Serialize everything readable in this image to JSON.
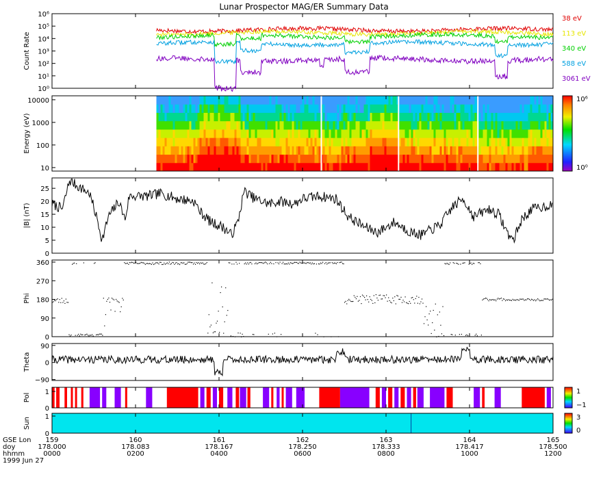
{
  "title": "Lunar Prospector MAG/ER Summary Data",
  "x_axis": {
    "rows": [
      {
        "label": "GSE Lon",
        "values": [
          "159",
          "160",
          "161",
          "162",
          "163",
          "164",
          "165"
        ]
      },
      {
        "label": "doy",
        "values": [
          "178.000",
          "178.083",
          "178.167",
          "178.250",
          "178.333",
          "178.417",
          "178.500"
        ]
      },
      {
        "label": "hhmm",
        "values": [
          "0000",
          "0200",
          "0400",
          "0600",
          "0800",
          "1000",
          "1200"
        ]
      }
    ],
    "date_label": "1999 Jun 27",
    "xlim_hours": [
      0,
      12
    ]
  },
  "colors": {
    "e38": "#e00000",
    "e113": "#e6e600",
    "e340": "#00d000",
    "e588": "#00a0e0",
    "e3061": "#8000c0",
    "pol_pos": "#ff0000",
    "pol_neg": "#8800ff",
    "sun": "#00e5ee"
  },
  "chart_data": [
    {
      "type": "line",
      "name": "count-rate",
      "ylabel": "Count Rate",
      "yscale": "log",
      "ylim": [
        1,
        1000000
      ],
      "yticks": [
        "10⁰",
        "10¹",
        "10²",
        "10³",
        "10⁴",
        "10⁵",
        "10⁶"
      ],
      "legend_placement": "right",
      "data_start_hour": 2.5,
      "series": [
        {
          "name": "38 eV",
          "color": "e38",
          "base_log10": 4.7
        },
        {
          "name": "113 eV",
          "color": "e113",
          "base_log10": 4.45
        },
        {
          "name": "340 eV",
          "color": "e340",
          "base_log10": 4.2
        },
        {
          "name": "588 eV",
          "color": "e588",
          "base_log10": 3.6
        },
        {
          "name": "3061 eV",
          "color": "e3061",
          "base_log10": 2.3
        }
      ]
    },
    {
      "type": "heatmap",
      "name": "energy-spectrogram",
      "ylabel": "Energy (eV)",
      "yscale": "log",
      "ylim": [
        7,
        15000
      ],
      "yticks": [
        "10",
        "100",
        "1000",
        "10000"
      ],
      "colorbar": {
        "min_label": "10⁰",
        "max_label": "10⁶"
      },
      "data_start_hour": 2.5,
      "gaps_hour": [
        6.45,
        8.3,
        10.2
      ]
    },
    {
      "type": "line",
      "name": "b-magnitude",
      "ylabel": "|B| (nT)",
      "ylim": [
        0,
        29
      ],
      "yticks": [
        "0",
        "5",
        "10",
        "15",
        "20",
        "25"
      ],
      "points": [
        [
          0,
          19
        ],
        [
          0.25,
          17
        ],
        [
          0.42,
          28
        ],
        [
          0.6,
          26
        ],
        [
          0.9,
          23
        ],
        [
          1.1,
          12
        ],
        [
          1.2,
          5
        ],
        [
          1.35,
          14
        ],
        [
          1.6,
          20
        ],
        [
          1.75,
          13
        ],
        [
          1.85,
          22
        ],
        [
          2.3,
          22
        ],
        [
          2.6,
          23
        ],
        [
          3,
          21
        ],
        [
          3.4,
          20
        ],
        [
          3.55,
          16
        ],
        [
          3.8,
          12
        ],
        [
          4.1,
          10
        ],
        [
          4.3,
          7
        ],
        [
          4.45,
          12
        ],
        [
          4.6,
          24
        ],
        [
          4.85,
          21
        ],
        [
          5.2,
          19
        ],
        [
          5.45,
          20
        ],
        [
          5.8,
          19
        ],
        [
          6,
          21
        ],
        [
          6.4,
          22
        ],
        [
          6.8,
          21
        ],
        [
          7.1,
          14
        ],
        [
          7.5,
          10
        ],
        [
          7.8,
          8
        ],
        [
          8.2,
          12
        ],
        [
          8.6,
          8
        ],
        [
          8.85,
          7
        ],
        [
          9.3,
          11
        ],
        [
          9.6,
          18
        ],
        [
          9.85,
          21
        ],
        [
          10.1,
          14
        ],
        [
          10.45,
          17
        ],
        [
          10.7,
          15
        ],
        [
          10.9,
          8
        ],
        [
          11.05,
          5
        ],
        [
          11.25,
          13
        ],
        [
          11.5,
          17
        ],
        [
          11.8,
          18
        ],
        [
          12,
          19
        ]
      ]
    },
    {
      "type": "scatter",
      "name": "phi",
      "ylabel": "Phi",
      "ylim": [
        0,
        370
      ],
      "yticks": [
        "0",
        "90",
        "180",
        "270",
        "360"
      ]
    },
    {
      "type": "line",
      "name": "theta",
      "ylabel": "Theta",
      "ylim": [
        -95,
        100
      ],
      "yticks": [
        "−90",
        "0",
        "90"
      ]
    },
    {
      "type": "bar",
      "name": "polarity",
      "ylabel": "Pol",
      "yticks": [
        "0",
        "1"
      ],
      "colorbar": {
        "max_label": "1",
        "min_label": "−1"
      },
      "segments": [
        {
          "start": 0.0,
          "end": 0.06,
          "state": 1
        },
        {
          "start": 0.1,
          "end": 0.18,
          "state": 1
        },
        {
          "start": 0.3,
          "end": 0.36,
          "state": 1
        },
        {
          "start": 0.45,
          "end": 0.5,
          "state": 1
        },
        {
          "start": 0.55,
          "end": 0.6,
          "state": 1
        },
        {
          "start": 0.7,
          "end": 0.75,
          "state": 1
        },
        {
          "start": 0.9,
          "end": 1.15,
          "state": -1
        },
        {
          "start": 1.2,
          "end": 1.3,
          "state": -1
        },
        {
          "start": 1.5,
          "end": 1.65,
          "state": -1
        },
        {
          "start": 1.75,
          "end": 1.8,
          "state": 1
        },
        {
          "start": 2.25,
          "end": 2.4,
          "state": -1
        },
        {
          "start": 2.75,
          "end": 3.5,
          "state": 1
        },
        {
          "start": 3.55,
          "end": 3.65,
          "state": -1
        },
        {
          "start": 3.7,
          "end": 3.8,
          "state": 1
        },
        {
          "start": 3.85,
          "end": 3.95,
          "state": -1
        },
        {
          "start": 4.0,
          "end": 4.1,
          "state": 1
        },
        {
          "start": 4.2,
          "end": 4.32,
          "state": -1
        },
        {
          "start": 4.4,
          "end": 4.48,
          "state": 1
        },
        {
          "start": 4.5,
          "end": 4.65,
          "state": -1
        },
        {
          "start": 4.68,
          "end": 4.75,
          "state": 1
        },
        {
          "start": 5.05,
          "end": 5.2,
          "state": -1
        },
        {
          "start": 5.25,
          "end": 5.3,
          "state": 1
        },
        {
          "start": 5.38,
          "end": 5.45,
          "state": -1
        },
        {
          "start": 5.5,
          "end": 5.55,
          "state": 1
        },
        {
          "start": 5.6,
          "end": 5.75,
          "state": -1
        },
        {
          "start": 5.85,
          "end": 6.05,
          "state": -1
        },
        {
          "start": 6.4,
          "end": 6.9,
          "state": 1
        },
        {
          "start": 6.9,
          "end": 7.6,
          "state": -1
        },
        {
          "start": 7.75,
          "end": 7.85,
          "state": 1
        },
        {
          "start": 7.9,
          "end": 8.0,
          "state": -1
        },
        {
          "start": 8.05,
          "end": 8.15,
          "state": 1
        },
        {
          "start": 8.2,
          "end": 8.3,
          "state": -1
        },
        {
          "start": 8.35,
          "end": 8.45,
          "state": 1
        },
        {
          "start": 8.5,
          "end": 8.6,
          "state": -1
        },
        {
          "start": 8.65,
          "end": 8.72,
          "state": 1
        },
        {
          "start": 8.75,
          "end": 8.9,
          "state": -1
        },
        {
          "start": 9.05,
          "end": 9.4,
          "state": -1
        },
        {
          "start": 9.45,
          "end": 9.6,
          "state": 1
        },
        {
          "start": 10.1,
          "end": 10.25,
          "state": -1
        },
        {
          "start": 10.3,
          "end": 10.36,
          "state": 1
        },
        {
          "start": 10.6,
          "end": 10.75,
          "state": -1
        },
        {
          "start": 11.25,
          "end": 11.8,
          "state": 1
        },
        {
          "start": 11.85,
          "end": 11.95,
          "state": -1
        }
      ]
    },
    {
      "type": "bar",
      "name": "sun",
      "ylabel": "Sun",
      "yticks": [
        "0",
        "1"
      ],
      "colorbar": {
        "max_label": "3",
        "min_label": "0"
      },
      "state_value": 1,
      "marker_hour": 8.6
    }
  ]
}
